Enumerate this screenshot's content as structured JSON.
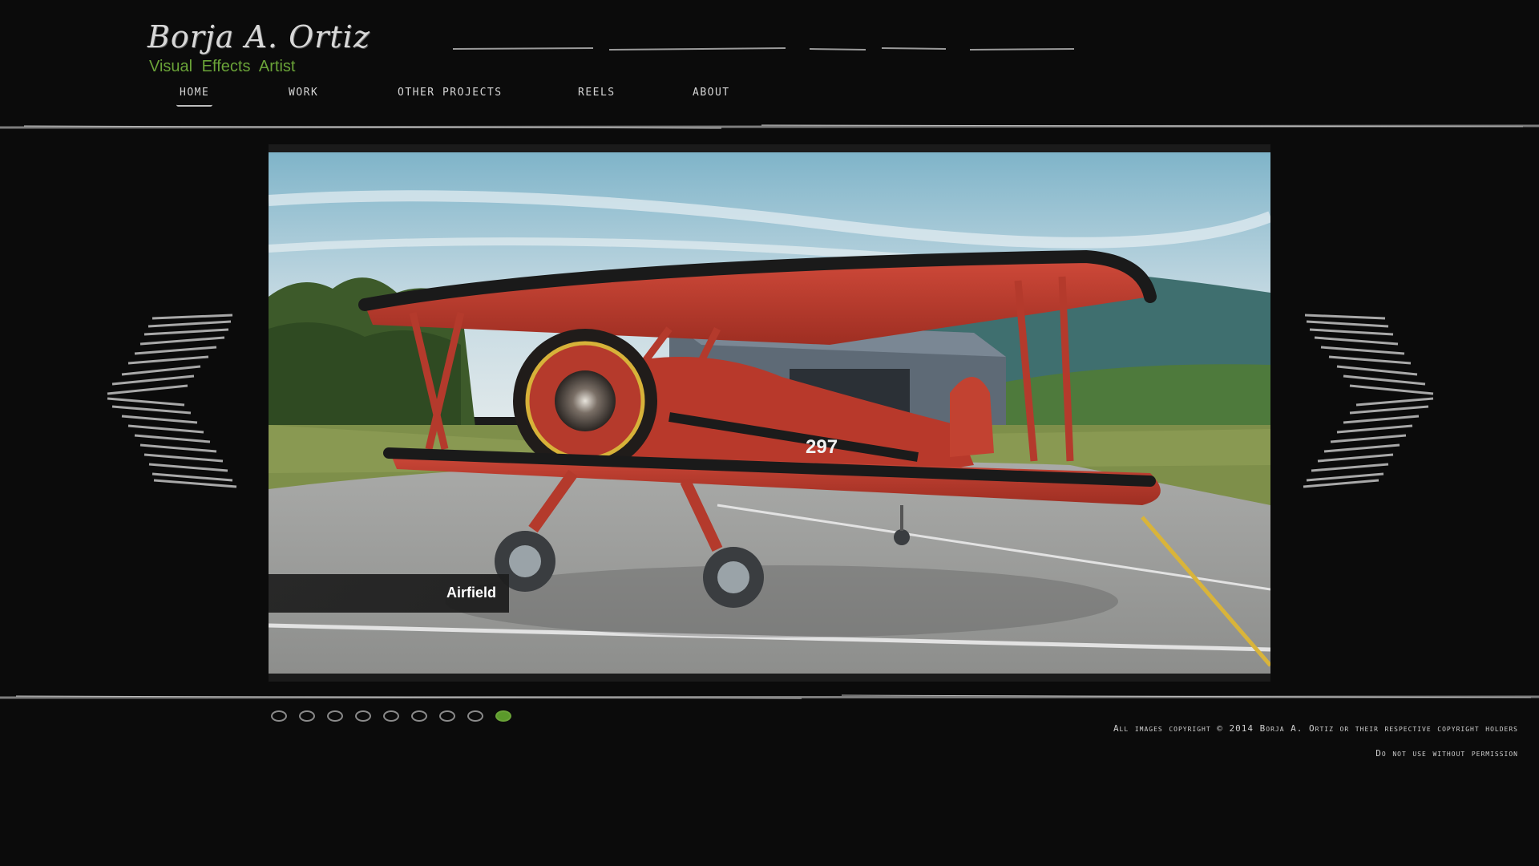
{
  "header": {
    "name": "Borja A. Ortiz",
    "subtitle": "Visual  Effects  Artist"
  },
  "nav": {
    "items": [
      {
        "label": "HOME",
        "active": true
      },
      {
        "label": "WORK",
        "active": false
      },
      {
        "label": "OTHER PROJECTS",
        "active": false
      },
      {
        "label": "REELS",
        "active": false
      },
      {
        "label": "ABOUT",
        "active": false
      }
    ]
  },
  "slider": {
    "caption": "Airfield",
    "slide_count": 9,
    "active_index": 8,
    "aircraft_number": "297",
    "prev_icon": "scribble-chevron-left-icon",
    "next_icon": "scribble-chevron-right-icon"
  },
  "footer": {
    "copyright": "All images copyright © 2014 Borja A. Ortiz or their respective copyright holders",
    "notice": "Do not use without permission"
  },
  "colors": {
    "background": "#0b0b0b",
    "accent_green": "#6aa338",
    "nav_text": "#d6d6d6"
  }
}
